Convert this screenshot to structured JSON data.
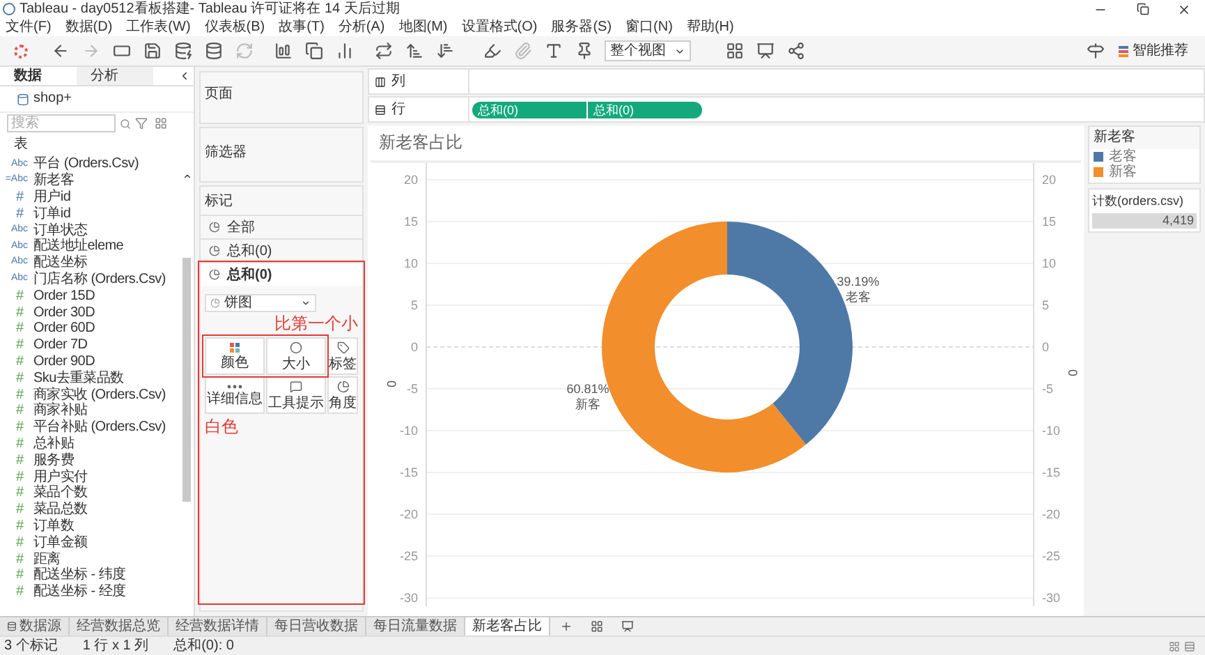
{
  "window": {
    "title": "Tableau - day0512看板搭建- Tableau 许可证将在 14 天后过期"
  },
  "menu": [
    "文件(F)",
    "数据(D)",
    "工作表(W)",
    "仪表板(B)",
    "故事(T)",
    "分析(A)",
    "地图(M)",
    "设置格式(O)",
    "服务器(S)",
    "窗口(N)",
    "帮助(H)"
  ],
  "toolbar": {
    "fit": "整个视图",
    "recommend": "智能推荐"
  },
  "data_pane": {
    "tabs": [
      {
        "label": "数据",
        "selected": true
      },
      {
        "label": "分析",
        "selected": false
      }
    ],
    "source": "shop+",
    "search": {
      "placeholder": "搜索"
    },
    "section": "表",
    "fields": [
      {
        "kind": "abc",
        "type_label": "Abc",
        "name": "平台 (Orders.Csv)"
      },
      {
        "kind": "calc",
        "type_label": "=Abc",
        "name": "新老客"
      },
      {
        "kind": "num",
        "type_label": "#",
        "name": "用户id"
      },
      {
        "kind": "num",
        "type_label": "#",
        "name": "订单id"
      },
      {
        "kind": "abc",
        "type_label": "Abc",
        "name": "订单状态"
      },
      {
        "kind": "abc",
        "type_label": "Abc",
        "name": "配送地址eleme"
      },
      {
        "kind": "abc",
        "type_label": "Abc",
        "name": "配送坐标"
      },
      {
        "kind": "abc",
        "type_label": "Abc",
        "name": "门店名称 (Orders.Csv)"
      },
      {
        "kind": "measure",
        "type_label": "#",
        "name": "Order 15D"
      },
      {
        "kind": "measure",
        "type_label": "#",
        "name": "Order 30D"
      },
      {
        "kind": "measure",
        "type_label": "#",
        "name": "Order 60D"
      },
      {
        "kind": "measure",
        "type_label": "#",
        "name": "Order 7D"
      },
      {
        "kind": "measure",
        "type_label": "#",
        "name": "Order 90D"
      },
      {
        "kind": "measure",
        "type_label": "#",
        "name": "Sku去重菜品数"
      },
      {
        "kind": "measure",
        "type_label": "#",
        "name": "商家实收 (Orders.Csv)"
      },
      {
        "kind": "measure",
        "type_label": "#",
        "name": "商家补贴"
      },
      {
        "kind": "measure",
        "type_label": "#",
        "name": "平台补贴 (Orders.Csv)"
      },
      {
        "kind": "measure",
        "type_label": "#",
        "name": "总补贴"
      },
      {
        "kind": "measure",
        "type_label": "#",
        "name": "服务费"
      },
      {
        "kind": "measure",
        "type_label": "#",
        "name": "用户实付"
      },
      {
        "kind": "measure",
        "type_label": "#",
        "name": "菜品个数"
      },
      {
        "kind": "measure",
        "type_label": "#",
        "name": "菜品总数"
      },
      {
        "kind": "measure",
        "type_label": "#",
        "name": "订单数"
      },
      {
        "kind": "measure",
        "type_label": "#",
        "name": "订单金额"
      },
      {
        "kind": "measure",
        "type_label": "#",
        "name": "距离"
      },
      {
        "kind": "measure",
        "type_label": "#",
        "name": "配送坐标 - 纬度"
      },
      {
        "kind": "measure",
        "type_label": "#",
        "name": "配送坐标 - 经度"
      }
    ]
  },
  "pages_card": {
    "title": "页面"
  },
  "filters_card": {
    "title": "筛选器"
  },
  "marks_card": {
    "title": "标记",
    "layers": [
      {
        "label": "全部",
        "selected": false
      },
      {
        "label": "总和(0)",
        "selected": false
      },
      {
        "label": "总和(0)",
        "selected": true
      }
    ],
    "mark_type": "饼图",
    "buttons": [
      "颜色",
      "大小",
      "标签",
      "详细信息",
      "工具提示",
      "角度"
    ],
    "annotations": [
      {
        "text": "比第一个小"
      },
      {
        "text": "白色"
      }
    ]
  },
  "shelves": [
    {
      "label": "列"
    },
    {
      "label": "行",
      "pills": [
        "总和(0)",
        "总和(0)"
      ]
    }
  ],
  "view": {
    "title": "新老客占比",
    "left_ticks": [
      "20",
      "15",
      "10",
      "5",
      "0",
      "-5",
      "-10",
      "-15",
      "-20",
      "-25",
      "-30"
    ],
    "right_ticks": [
      "20",
      "15",
      "10",
      "5",
      "0",
      "-5",
      "-10",
      "-15",
      "-20",
      "-25",
      "-30"
    ],
    "left_axis_title": "0",
    "right_axis_title": "0",
    "chart_data": {
      "type": "donut",
      "categories": [
        "老客",
        "新客"
      ],
      "values": [
        39.19,
        60.81
      ],
      "colors": [
        "#4e79a7",
        "#f28e2b"
      ],
      "value_labels": [
        "39.19%",
        "60.81%"
      ]
    }
  },
  "color_legend": {
    "title": "新老客",
    "items": [
      {
        "label": "老客",
        "color": "#4e79a7"
      },
      {
        "label": "新客",
        "color": "#f28e2b"
      }
    ]
  },
  "size_legend": {
    "title": "计数(orders.csv)",
    "value": "4,419"
  },
  "sheet_tabs": [
    {
      "label": "数据源",
      "selected": false
    },
    {
      "label": "经营数据总览",
      "selected": false
    },
    {
      "label": "经营数据详情",
      "selected": false
    },
    {
      "label": "每日营收数据",
      "selected": false
    },
    {
      "label": "每日流量数据",
      "selected": false
    },
    {
      "label": "新老客占比",
      "selected": true
    }
  ],
  "status_bar": [
    "3 个标记",
    "1 行 x 1 列",
    "总和(0): 0"
  ]
}
